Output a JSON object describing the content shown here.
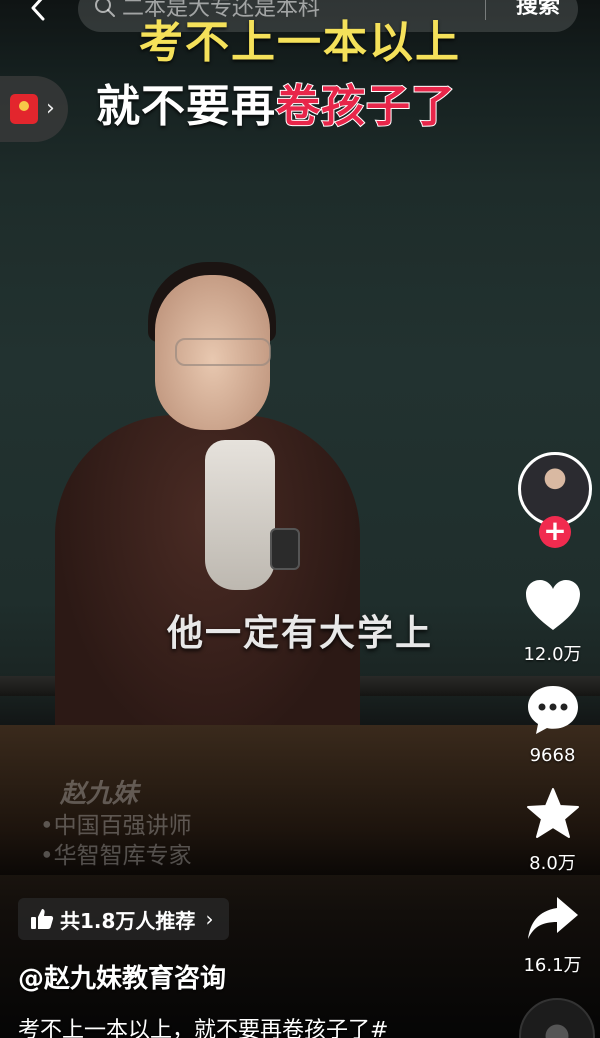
{
  "search": {
    "placeholder": "二本是大专还是本科",
    "button_label": "搜索"
  },
  "video": {
    "caption_line1": "考不上一本以上",
    "caption_line2_plain": "就不要再",
    "caption_line2_highlight": "卷孩子了",
    "subtitle": "他一定有大学上",
    "watermark": {
      "name": "赵九妹",
      "lines": [
        "•中国百强讲师",
        "•华智智库专家"
      ]
    }
  },
  "actions": {
    "like_count": "12.0万",
    "comment_count": "9668",
    "favorite_count": "8.0万",
    "share_count": "16.1万"
  },
  "info": {
    "recommend_text": "共1.8万人推荐",
    "author": "@赵九妹教育咨询",
    "description": "考不上一本以上，就不要再卷孩子了#"
  },
  "colors": {
    "caption_yellow": "#f5e15a",
    "highlight_red": "#e8264a",
    "follow_red": "#f12b4f"
  }
}
